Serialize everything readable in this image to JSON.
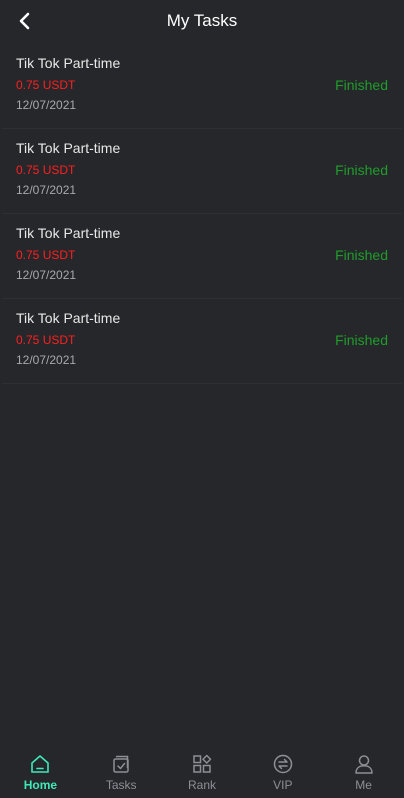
{
  "header": {
    "title": "My Tasks",
    "back_icon": "chevron-left-icon"
  },
  "tasks": [
    {
      "name": "Tik Tok Part-time",
      "amount": "0.75 USDT",
      "date": "12/07/2021",
      "status": "Finished"
    },
    {
      "name": "Tik Tok Part-time",
      "amount": "0.75 USDT",
      "date": "12/07/2021",
      "status": "Finished"
    },
    {
      "name": "Tik Tok Part-time",
      "amount": "0.75 USDT",
      "date": "12/07/2021",
      "status": "Finished"
    },
    {
      "name": "Tik Tok Part-time",
      "amount": "0.75 USDT",
      "date": "12/07/2021",
      "status": "Finished"
    }
  ],
  "tabbar": {
    "items": [
      {
        "label": "Home",
        "icon": "home-icon",
        "active": true
      },
      {
        "label": "Tasks",
        "icon": "tasks-icon",
        "active": false
      },
      {
        "label": "Rank",
        "icon": "rank-icon",
        "active": false
      },
      {
        "label": "VIP",
        "icon": "vip-icon",
        "active": false
      },
      {
        "label": "Me",
        "icon": "user-icon",
        "active": false
      }
    ]
  },
  "colors": {
    "background": "#26272b",
    "amount": "#ff1f1f",
    "status_finished": "#1f9d2b",
    "tab_active": "#3ee8b8",
    "tab_inactive": "#8e8f94"
  }
}
